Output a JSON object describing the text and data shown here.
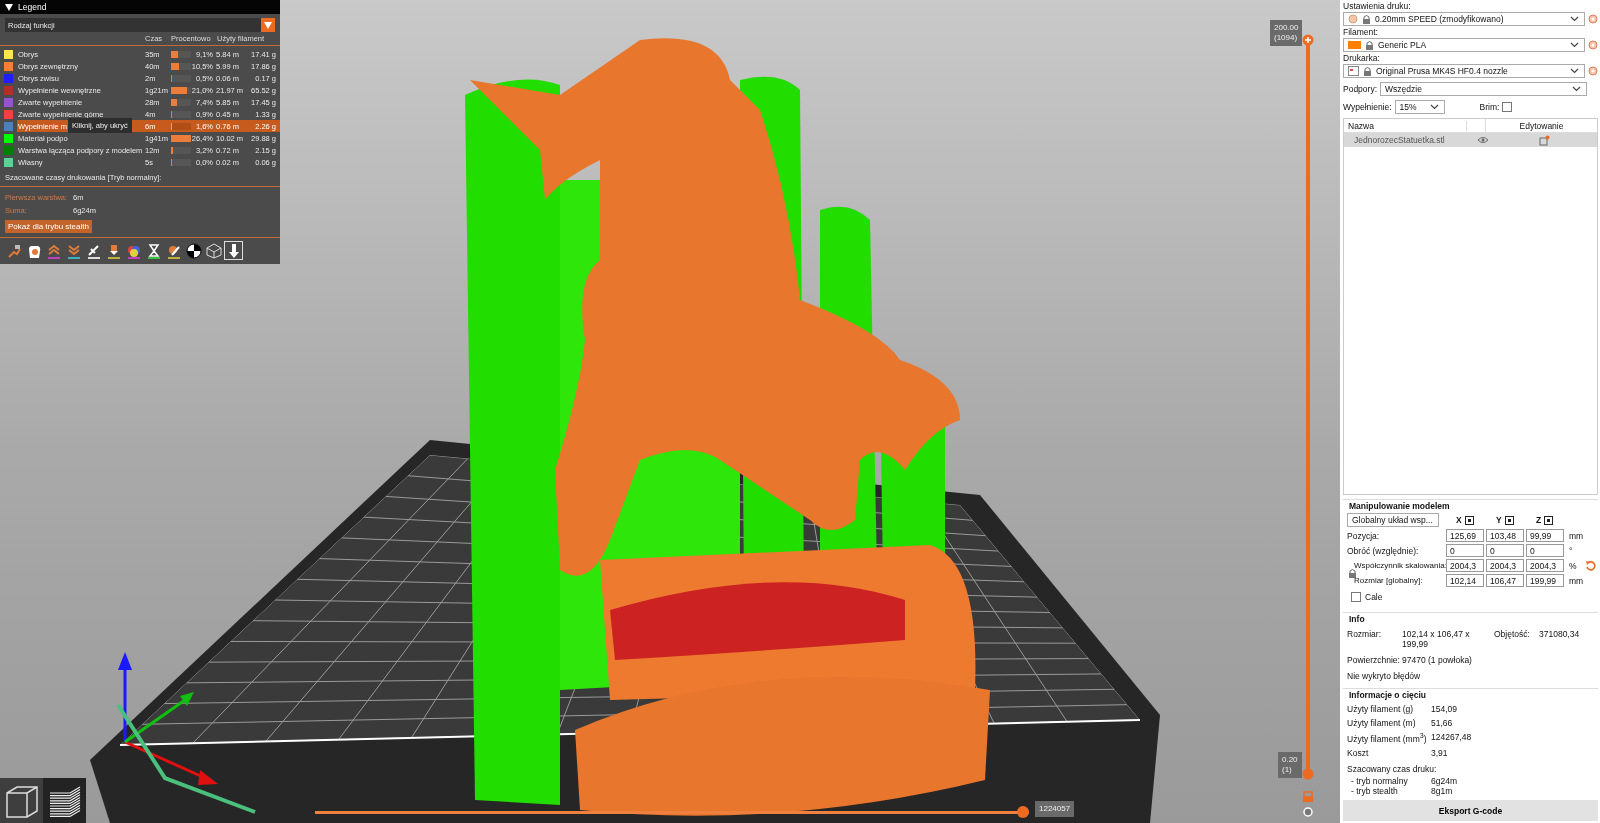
{
  "legend": {
    "title": "Legend",
    "expanded": true,
    "view_type": "Rodzaj funkcji",
    "columns": [
      "Czas",
      "Procentowo",
      "Użyty filament"
    ],
    "rows": [
      {
        "name": "Obrys",
        "color": "#ffe64d",
        "time": "35m",
        "level": 0.34,
        "percent": "9,1%",
        "length": "5.84 m",
        "weight": "17.41 g",
        "selected": false
      },
      {
        "name": "Obrys zewnętrzny",
        "color": "#ff7d38",
        "time": "40m",
        "level": 0.4,
        "percent": "10,5%",
        "length": "5.99 m",
        "weight": "17.86 g",
        "selected": false
      },
      {
        "name": "Obrys zwisu",
        "color": "#1f1fff",
        "time": "2m",
        "level": 0.02,
        "percent": "0,5%",
        "length": "0.06 m",
        "weight": "0.17 g",
        "selected": false
      },
      {
        "name": "Wypełnienie wewnętrzne",
        "color": "#b03029",
        "time": "1g21m",
        "level": 0.79,
        "percent": "21,0%",
        "length": "21.97 m",
        "weight": "65.52 g",
        "selected": false
      },
      {
        "name": "Zwarte wypełnienie",
        "color": "#9654cc",
        "time": "28m",
        "level": 0.28,
        "percent": "7,4%",
        "length": "5.85 m",
        "weight": "17.45 g",
        "selected": false
      },
      {
        "name": "Zwarte wypełnienie górne",
        "color": "#f04040",
        "time": "4m",
        "level": 0.03,
        "percent": "0,9%",
        "length": "0.45 m",
        "weight": "1.33 g",
        "selected": false
      },
      {
        "name": "Wypełnienie m",
        "color": "#4d80ba",
        "time": "6m",
        "level": 0.06,
        "percent": "1,6%",
        "length": "0.76 m",
        "weight": "2.26 g",
        "selected": true
      },
      {
        "name": "Materiał podpo",
        "color": "#00ff00",
        "time": "1g41m",
        "level": 1.0,
        "percent": "26,4%",
        "length": "10.02 m",
        "weight": "29.88 g",
        "selected": false
      },
      {
        "name": "Warstwa łącząca podpory z modelem",
        "color": "#008000",
        "time": "12m",
        "level": 0.12,
        "percent": "3,2%",
        "length": "0.72 m",
        "weight": "2.15 g",
        "selected": false
      },
      {
        "name": "Własny",
        "color": "#5ed194",
        "time": "5s",
        "level": 0.0,
        "percent": "0,0%",
        "length": "0.02 m",
        "weight": "0.06 g",
        "selected": false
      }
    ],
    "tooltip": "Kliknij, aby ukryć",
    "estimate_title": "Szacowane czasy drukowania [Tryb normalny]:",
    "times": [
      {
        "label": "Pierwsza warstwa:",
        "value": "6m"
      },
      {
        "label": "Suma:",
        "value": "6g24m"
      }
    ],
    "stealth_button": "Pokaż dla trybu stealth",
    "toolbar": [
      {
        "kind": "travel",
        "selected": false
      },
      {
        "kind": "wipe",
        "selected": false
      },
      {
        "kind": "retract",
        "selected": false
      },
      {
        "kind": "deretract",
        "selected": false
      },
      {
        "kind": "seams",
        "selected": false
      },
      {
        "kind": "toolchange",
        "selected": false
      },
      {
        "kind": "colorchange",
        "selected": false
      },
      {
        "kind": "pause",
        "selected": false
      },
      {
        "kind": "custom",
        "selected": false
      },
      {
        "kind": "cog",
        "selected": false
      },
      {
        "kind": "shells",
        "selected": false
      },
      {
        "kind": "marker",
        "selected": true
      }
    ]
  },
  "viewport": {
    "layer_slider": {
      "top_value": "200.00",
      "top_layer": "(1094)",
      "bottom_value": "0.20",
      "bottom_layer": "(1)"
    },
    "move_slider": {
      "value": "1224057",
      "level": 1.0
    },
    "view_buttons": [
      {
        "kind": "model",
        "selected": false
      },
      {
        "kind": "preview",
        "selected": true
      }
    ]
  },
  "sidebar": {
    "presets": [
      {
        "label": "Ustawienia druku:",
        "kind": "print",
        "value": "0.20mm SPEED (zmodyfikowano)"
      },
      {
        "label": "Filament:",
        "kind": "filament",
        "color": "#ff8000",
        "value": "Generic PLA"
      },
      {
        "label": "Drukarka:",
        "kind": "printer",
        "value": "Original Prusa MK4S HF0.4 nozzle"
      }
    ],
    "supports": {
      "label": "Podpory:",
      "value": "Wszędzie"
    },
    "infill": {
      "label": "Wypełnienie:",
      "value": "15%"
    },
    "brim": {
      "label": "Brim:",
      "checked": false
    },
    "objects": {
      "columns": [
        "Nazwa",
        "Edytowanie"
      ],
      "rows": [
        {
          "name": "JednorozecStatuetka.stl",
          "selected": true
        }
      ]
    },
    "manipulation": {
      "title": "Manipulowanie modelem",
      "coord_system": "Globalny układ wsp...",
      "axes": [
        "X",
        "Y",
        "Z"
      ],
      "rows": [
        {
          "label": "Pozycja:",
          "values": [
            "125,69",
            "103,48",
            "99,99"
          ],
          "unit": "mm"
        },
        {
          "label": "Obróć (względnie):",
          "values": [
            "0",
            "0",
            "0"
          ],
          "unit": "°"
        },
        {
          "label": "Współczynnik skalowania:",
          "values": [
            "2004,3",
            "2004,3",
            "2004,3"
          ],
          "unit": "%"
        },
        {
          "label": "Rozmiar [globalny]:",
          "values": [
            "102,14",
            "106,47",
            "199,99"
          ],
          "unit": "mm"
        }
      ],
      "inches": {
        "label": "Cale",
        "checked": false
      }
    },
    "info": {
      "title": "Info",
      "size_label": "Rozmiar:",
      "size": "102,14 x 106,47 x 199,99",
      "volume_label": "Objętość:",
      "volume": "371080,34",
      "facets_label": "Powierzchnie:",
      "facets": "97470 (1 powłoka)",
      "errors": "Nie wykryto błędów"
    },
    "slice_info": {
      "title": "Informacje o cięciu",
      "rows": [
        {
          "label": "Użyty filament (g)",
          "value": "154,09"
        },
        {
          "label": "Użyty filament (m)",
          "value": "51,66"
        },
        {
          "label": "Użyty filament (mm$^{3}$)",
          "value": "124267,48"
        },
        {
          "label": "Koszt",
          "value": "3,91"
        }
      ],
      "time_title": "Szacowany czas druku:",
      "times": [
        {
          "label": "- tryb normalny",
          "value": "6g24m"
        },
        {
          "label": "- tryb stealth",
          "value": "8g1m"
        }
      ]
    },
    "export_button": "Eksport G-code"
  }
}
